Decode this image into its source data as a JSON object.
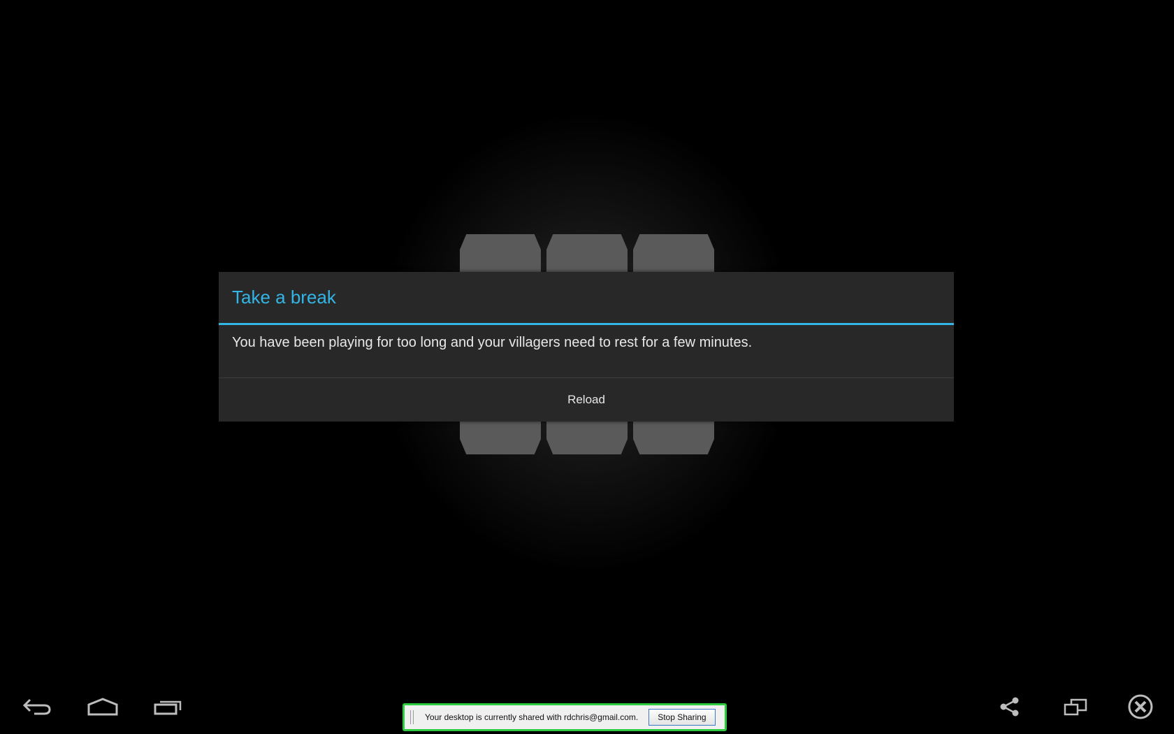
{
  "dialog": {
    "title": "Take a break",
    "message": "You have been playing for too long and your villagers need to rest for a few minutes.",
    "button_label": "Reload"
  },
  "navbar": {
    "left_icons": [
      "back-icon",
      "home-icon",
      "recent-apps-icon"
    ],
    "right_icons": [
      "share-icon",
      "screen-rotate-icon",
      "close-icon"
    ]
  },
  "share_bar": {
    "message": "Your desktop is currently shared with rdchris@gmail.com.",
    "stop_label": "Stop Sharing",
    "border_color": "#2ecc40"
  },
  "colors": {
    "accent": "#33b5e5",
    "dialog_bg": "#282828"
  }
}
